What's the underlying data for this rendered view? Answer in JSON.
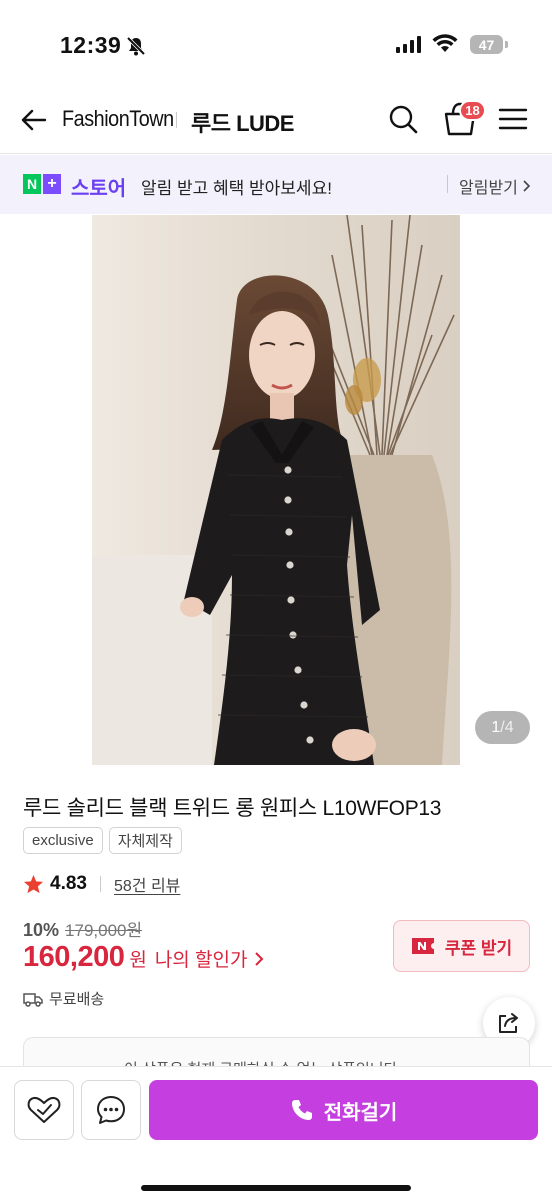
{
  "status_bar": {
    "time": "12:39",
    "battery": "47",
    "icons": [
      "bell-slash-icon",
      "cellular-signal-icon",
      "wifi-icon",
      "battery-icon"
    ]
  },
  "header": {
    "brand": "FashionTown",
    "store": "루드 LUDE",
    "cart_count": "18",
    "icons": [
      "back-arrow-icon",
      "search-icon",
      "shopping-bag-icon",
      "hamburger-menu-icon"
    ]
  },
  "store_banner": {
    "logo_n": "N",
    "logo_plus": "+",
    "store_word": "스토어",
    "message": "알림 받고 혜택 받아보세요!",
    "link": "알림받기"
  },
  "gallery": {
    "current": "1",
    "separator": " / ",
    "total": "4"
  },
  "product": {
    "title": "루드 솔리드 블랙 트위드 롱 원피스 L10WFOP13",
    "tags": [
      "exclusive",
      "자체제작"
    ],
    "rating": "4.83",
    "reviews": "58건 리뷰",
    "discount_rate": "10%",
    "original_price": "179,000원",
    "sale_price": "160,200",
    "price_unit": "원",
    "my_price_label": "나의 할인가",
    "coupon_label": "쿠폰 받기",
    "shipping": "무료배송",
    "notice_partial": "이 상품은 현재 구매하실 수 없는 상품입니다"
  },
  "bottom_bar": {
    "call_label": "전화걸기"
  },
  "colors": {
    "accent_purple": "#c53ee0",
    "price_red": "#d7263d",
    "naver_green": "#03c75a",
    "store_purple": "#6b3ff2",
    "badge_red": "#e94b52"
  }
}
